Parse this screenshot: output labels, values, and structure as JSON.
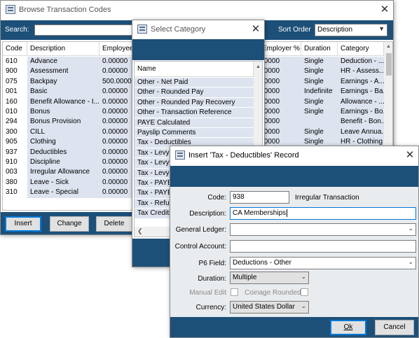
{
  "browse": {
    "title": "Browse Transaction Codes",
    "close": "✕",
    "search_label": "Search:",
    "search_value": "",
    "sort_label": "Sort Order",
    "sort_value": "Description",
    "columns": [
      "Code",
      "Description",
      "Employee Amt",
      "Employer %",
      "Duration",
      "Category"
    ],
    "rows": [
      {
        "code": "610",
        "desc": "Advance",
        "emp": "0.00000",
        "er": ".0000",
        "dur": "Single",
        "cat": "Deduction - ..."
      },
      {
        "code": "900",
        "desc": "Assessment",
        "emp": "0.00000",
        "er": ".0000",
        "dur": "Single",
        "cat": "HR - Assess..."
      },
      {
        "code": "075",
        "desc": "Backpay",
        "emp": "500.00000",
        "er": ".0000",
        "dur": "Single",
        "cat": "Earnings - A..."
      },
      {
        "code": "001",
        "desc": "Basic",
        "emp": "0.00000",
        "er": ".0000",
        "dur": "Indefinite",
        "cat": "Earnings - Ba..."
      },
      {
        "code": "160",
        "desc": "Benefit Allowance - I...",
        "emp": "0.00000",
        "er": ".0000",
        "dur": "Single",
        "cat": "Allowance - ..."
      },
      {
        "code": "010",
        "desc": "Bonus",
        "emp": "0.00000",
        "er": ".0000",
        "dur": "Single",
        "cat": "Earnings - Bo..."
      },
      {
        "code": "294",
        "desc": "Bonus Provision",
        "emp": "0.00000",
        "er": ".0000",
        "dur": "",
        "cat": "Benefit - Bon..."
      },
      {
        "code": "300",
        "desc": "CILL",
        "emp": "0.00000",
        "er": ".0000",
        "dur": "Single",
        "cat": "Leave Annua..."
      },
      {
        "code": "905",
        "desc": "Clothing",
        "emp": "0.00000",
        "er": ".0000",
        "dur": "Single",
        "cat": "HR - Clothing"
      },
      {
        "code": "937",
        "desc": "Deductibles",
        "emp": "0.00000",
        "er": "",
        "dur": "",
        "cat": ""
      },
      {
        "code": "910",
        "desc": "Discipline",
        "emp": "0.00000",
        "er": "",
        "dur": "",
        "cat": ""
      },
      {
        "code": "003",
        "desc": "Irregular Allowance",
        "emp": "0.00000",
        "er": "",
        "dur": "",
        "cat": ""
      },
      {
        "code": "380",
        "desc": "Leave - Sick",
        "emp": "0.00000",
        "er": "",
        "dur": "",
        "cat": ""
      },
      {
        "code": "310",
        "desc": "Leave - Special",
        "emp": "0.00000",
        "er": "",
        "dur": "",
        "cat": ""
      }
    ],
    "buttons": {
      "insert": "Insert",
      "change": "Change",
      "delete": "Delete"
    }
  },
  "category": {
    "title": "Select Category",
    "close": "✕",
    "column": "Name",
    "items": [
      "Other - Net Paid",
      "Other - Rounded Pay",
      "Other - Rounded Pay Recovery",
      "Other - Transaction Reference",
      "PAYE Calculated",
      "Payslip Comments",
      "Tax - Deductibles",
      "Tax - Levy",
      "Tax - Levy A",
      "Tax - Levy A",
      "Tax - PAYE",
      "Tax - PAYE",
      "Tax - Refun",
      "Tax Credits"
    ]
  },
  "insert": {
    "title": "Insert 'Tax - Deductibles' Record",
    "close": "✕",
    "code_label": "Code:",
    "code_value": "938",
    "code_note": "Irregular Transaction",
    "desc_label": "Description:",
    "desc_value": "CA Memberships",
    "gl_label": "General Ledger:",
    "gl_value": "",
    "control_label": "Control Account:",
    "control_value": "",
    "p6_label": "P6 Field:",
    "p6_value": "Deductions - Other",
    "duration_label": "Duration:",
    "duration_value": "Multiple",
    "manual_edit_label": "Manual Edit",
    "coinage_label": "Coinage Rounded",
    "currency_label": "Currency:",
    "currency_value": "United States Dollar",
    "ok_label": "Ok",
    "cancel_label": "Cancel"
  },
  "colors": {
    "navy": "#1d5079",
    "row_shade": "#dde3ef",
    "default_button_border": "#0078d7"
  }
}
